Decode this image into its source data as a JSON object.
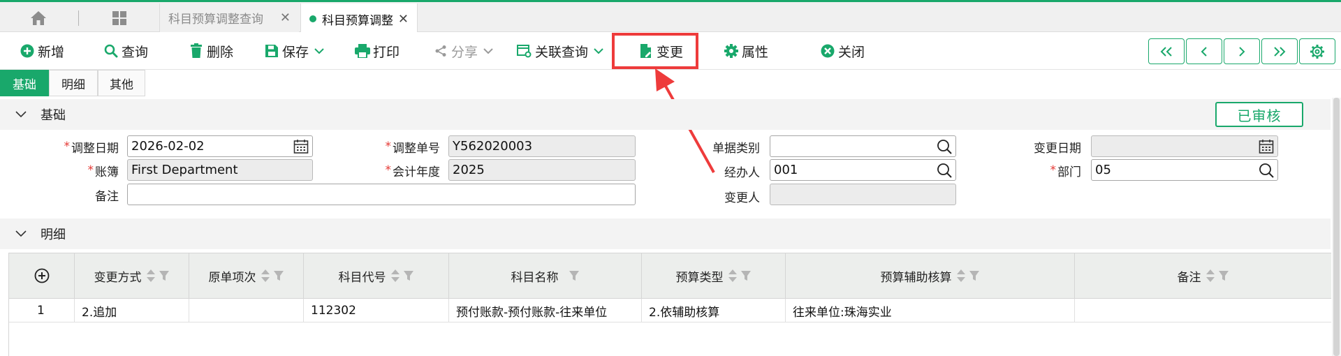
{
  "tabs": {
    "inactive_label": "科目预算调整查询",
    "active_label": "科目预算调整",
    "close_glyph": "✕"
  },
  "toolbar": {
    "new": "新增",
    "query": "查询",
    "delete": "删除",
    "save": "保存",
    "print": "打印",
    "share": "分享",
    "related_query": "关联查询",
    "change": "变更",
    "properties": "属性",
    "close": "关闭"
  },
  "form_tabs": [
    "基础",
    "明细",
    "其他"
  ],
  "sections": {
    "basic": "基础",
    "detail": "明细"
  },
  "status": "已审核",
  "form": {
    "adjust_date_label": "调整日期",
    "adjust_date_value": "2026-02-02",
    "adjust_no_label": "调整单号",
    "adjust_no_value": "Y562020003",
    "doc_type_label": "单据类别",
    "doc_type_value": "",
    "change_date_label": "变更日期",
    "change_date_value": "",
    "ledger_label": "账簿",
    "ledger_value": "First Department",
    "fiscal_year_label": "会计年度",
    "fiscal_year_value": "2025",
    "handler_label": "经办人",
    "handler_value": "001",
    "dept_label": "部门",
    "dept_value": "05",
    "remark_label": "备注",
    "remark_value": "",
    "changer_label": "变更人",
    "changer_value": ""
  },
  "table": {
    "columns": [
      "变更方式",
      "原单项次",
      "科目代号",
      "科目名称",
      "预算类型",
      "预算辅助核算",
      "备注"
    ],
    "rows": [
      [
        "1",
        "2.追加",
        "",
        "112302",
        "预付账款-预付账款-往来单位",
        "2.依辅助核算",
        "往来单位:珠海实业",
        ""
      ]
    ]
  },
  "colors": {
    "accent": "#19a86b",
    "highlight": "#ee3b3b",
    "required": "#e53935"
  }
}
